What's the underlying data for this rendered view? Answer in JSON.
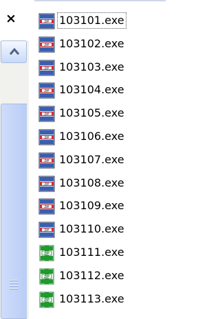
{
  "pane": {
    "close_glyph": "×"
  },
  "files": [
    {
      "name": "103101.exe",
      "icon": "winzip-archive-icon",
      "style": "blue",
      "focused": true
    },
    {
      "name": "103102.exe",
      "icon": "winzip-archive-icon",
      "style": "blue",
      "focused": false
    },
    {
      "name": "103103.exe",
      "icon": "winzip-archive-icon",
      "style": "blue",
      "focused": false
    },
    {
      "name": "103104.exe",
      "icon": "winzip-archive-icon",
      "style": "blue",
      "focused": false
    },
    {
      "name": "103105.exe",
      "icon": "winzip-archive-icon",
      "style": "blue",
      "focused": false
    },
    {
      "name": "103106.exe",
      "icon": "winzip-archive-icon",
      "style": "blue",
      "focused": false
    },
    {
      "name": "103107.exe",
      "icon": "winzip-archive-icon",
      "style": "blue",
      "focused": false
    },
    {
      "name": "103108.exe",
      "icon": "winzip-archive-icon",
      "style": "blue",
      "focused": false
    },
    {
      "name": "103109.exe",
      "icon": "winzip-archive-icon",
      "style": "blue",
      "focused": false
    },
    {
      "name": "103110.exe",
      "icon": "winzip-archive-icon",
      "style": "blue",
      "focused": false
    },
    {
      "name": "103111.exe",
      "icon": "zip-archive-icon",
      "style": "green",
      "focused": false
    },
    {
      "name": "103112.exe",
      "icon": "zip-archive-icon",
      "style": "green",
      "focused": false
    },
    {
      "name": "103113.exe",
      "icon": "zip-archive-icon",
      "style": "green",
      "focused": false
    }
  ],
  "colors": {
    "scroll_button": "#c8daf8",
    "scroll_track": "#f1f1ee",
    "icon_blue": "#3a5fb0",
    "icon_green": "#1e9a2e"
  }
}
